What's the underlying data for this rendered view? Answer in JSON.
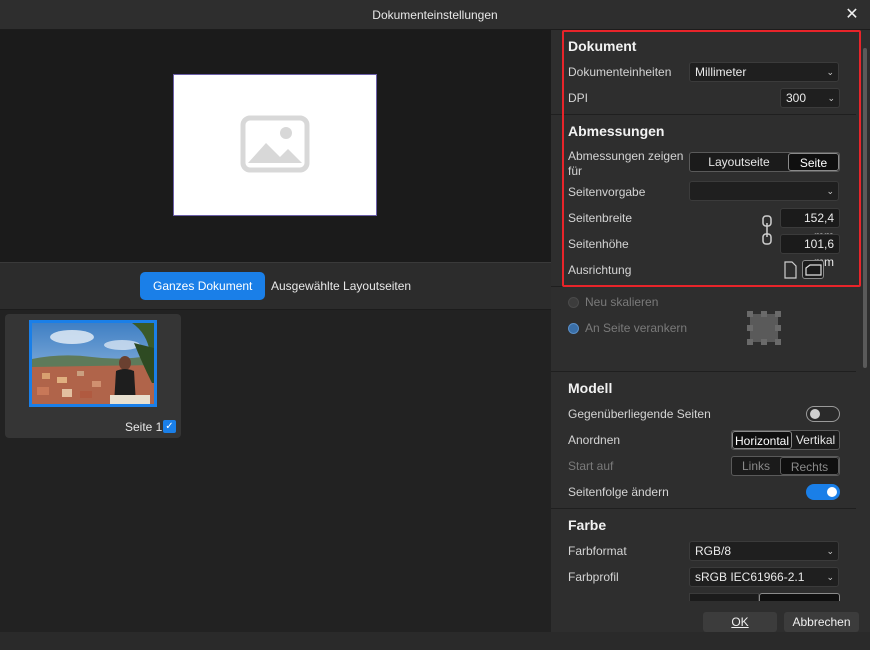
{
  "window": {
    "title": "Dokumenteinstellungen",
    "close_icon": "close-icon"
  },
  "preview": {
    "placeholder_icon": "image-placeholder-icon"
  },
  "view_toggle": {
    "whole_document": "Ganzes Dokument",
    "selected_spreads": "Ausgewählte Layoutseiten"
  },
  "thumbnail": {
    "label": "Seite 1",
    "checked": true
  },
  "document": {
    "title": "Dokument",
    "units_label": "Dokumenteinheiten",
    "units_value": "Millimeter",
    "dpi_label": "DPI",
    "dpi_value": "300"
  },
  "dimensions": {
    "title": "Abmessungen",
    "show_for_label_line1": "Abmessungen zeigen",
    "show_for_label_line2": "für",
    "show_for_options": [
      "Layoutseite",
      "Seite"
    ],
    "preset_label": "Seitenvorgabe",
    "preset_value": "",
    "width_label": "Seitenbreite",
    "width_value": "152,4 mm",
    "height_label": "Seitenhöhe",
    "height_value": "101,6 mm",
    "orientation_label": "Ausrichtung"
  },
  "scaling": {
    "rescale": "Neu skalieren",
    "anchor": "An Seite verankern"
  },
  "model": {
    "title": "Modell",
    "facing_label": "Gegenüberliegende Seiten",
    "facing_on": false,
    "arrange_label": "Anordnen",
    "arrange_options": [
      "Horizontal",
      "Vertikal"
    ],
    "start_label": "Start auf",
    "start_options": [
      "Links",
      "Rechts"
    ],
    "page_order_label": "Seitenfolge ändern",
    "page_order_on": true
  },
  "color": {
    "title": "Farbe",
    "format_label": "Farbformat",
    "format_value": "RGB/8",
    "profile_label": "Farbprofil",
    "profile_value": "sRGB IEC61966-2.1"
  },
  "footer": {
    "ok": "OK",
    "cancel": "Abbrechen"
  }
}
